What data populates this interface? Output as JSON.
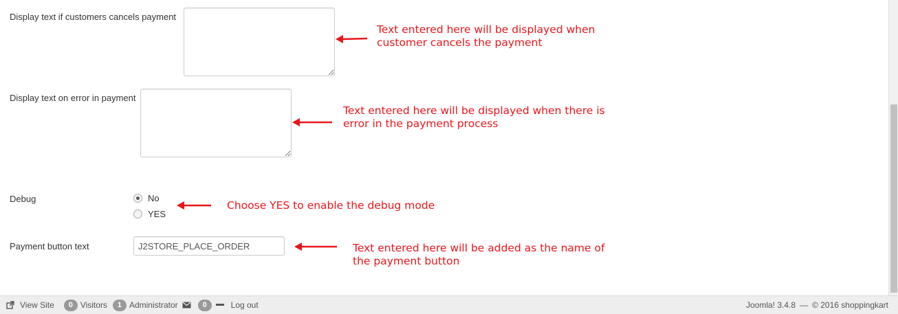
{
  "form": {
    "cancel_label": "Display text if customers cancels payment",
    "error_label": "Display text on error in payment",
    "debug_label": "Debug",
    "debug_options": [
      "No",
      "YES"
    ],
    "debug_selected": "No",
    "button_text_label": "Payment button text",
    "button_text_value": "J2STORE_PLACE_ORDER"
  },
  "annotations": {
    "cancel_line1": "Text entered here will be displayed when",
    "cancel_line2": "customer cancels the payment",
    "error_line1": "Text entered here will be displayed when there is",
    "error_line2": "error in the payment process",
    "debug_line1": "Choose YES to enable the debug mode",
    "button_line1": "Text entered here will be added as the name of",
    "button_line2": "the payment button"
  },
  "footer": {
    "view_site": "View Site",
    "visitors_count": "0",
    "visitors_label": "Visitors",
    "admin_count": "1",
    "admin_label": "Administrator",
    "messages_count": "0",
    "logout": "Log out",
    "version": "Joomla! 3.4.8",
    "separator": "—",
    "copyright": "© 2016 shoppingkart"
  },
  "colors": {
    "annotation": "#e8161b",
    "badge": "#999999",
    "footer_bg": "#eeeeee"
  },
  "icons": [
    "external-link-icon",
    "envelope-icon",
    "minus-icon",
    "red-arrow-icon"
  ]
}
